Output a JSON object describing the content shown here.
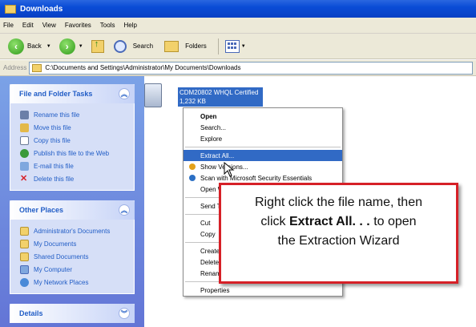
{
  "window": {
    "title": "Downloads"
  },
  "menu": [
    "File",
    "Edit",
    "View",
    "Favorites",
    "Tools",
    "Help"
  ],
  "toolbar": {
    "back": "Back",
    "search": "Search",
    "folders": "Folders"
  },
  "address": {
    "label": "Address",
    "path": "C:\\Documents and Settings\\Administrator\\My Documents\\Downloads"
  },
  "file_tasks": {
    "title": "File and Folder Tasks",
    "items": [
      "Rename this file",
      "Move this file",
      "Copy this file",
      "Publish this file to the Web",
      "E-mail this file",
      "Delete this file"
    ]
  },
  "other_places": {
    "title": "Other Places",
    "items": [
      "Administrator's Documents",
      "My Documents",
      "Shared Documents",
      "My Computer",
      "My Network Places"
    ]
  },
  "details": {
    "title": "Details"
  },
  "file": {
    "name": "CDM20802 WHQL Certified",
    "size": "1,232 KB"
  },
  "context_menu": {
    "open": "Open",
    "search": "Search...",
    "explore": "Explore",
    "extract_all": "Extract All...",
    "show_versions": "Show Versions...",
    "scan": "Scan with Microsoft Security Essentials",
    "open_with": "Open With",
    "send_to": "Send To",
    "cut": "Cut",
    "copy": "Copy",
    "create_shortcut": "Create Shortcut",
    "delete": "Delete",
    "rename": "Rename",
    "properties": "Properties"
  },
  "callout": {
    "line1": "Right click the file name, then",
    "line2_pre": "click ",
    "line2_bold": "Extract All. . .",
    "line2_post": " to open",
    "line3": "the Extraction Wizard"
  },
  "colors": {
    "title_bar": "#0a4cd6",
    "task_pane": "#6375d6",
    "highlight": "#316ac5",
    "callout_border": "#d62027"
  }
}
